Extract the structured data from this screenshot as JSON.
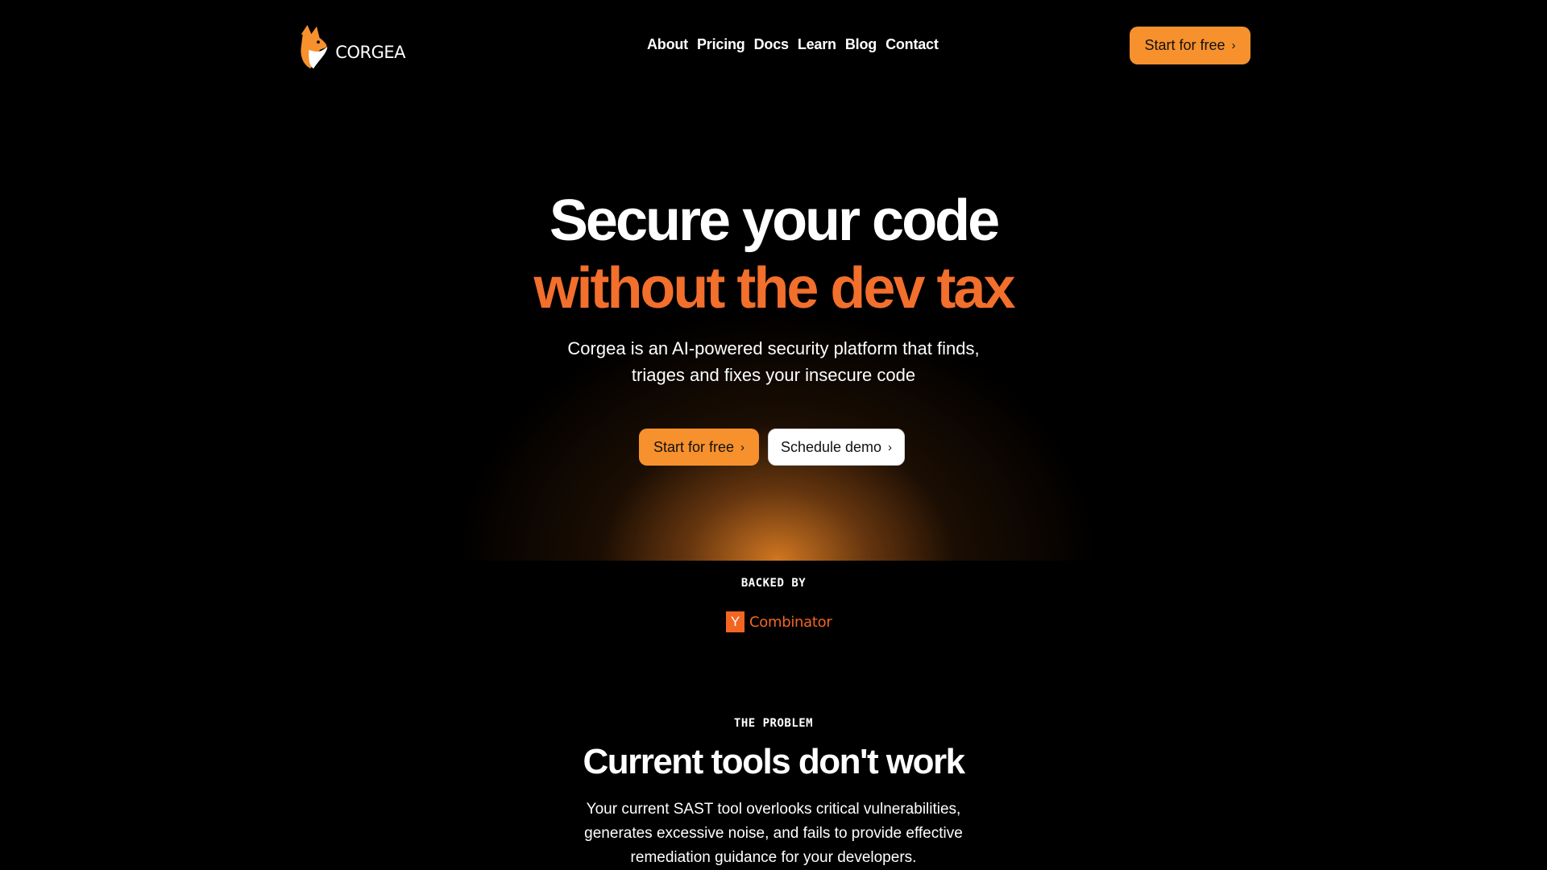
{
  "brand": {
    "logo_text": "CORGEA",
    "accent_color": "#f7912d",
    "headline_accent_color": "#f26f2c",
    "logo_icon": "corgi-icon"
  },
  "nav": {
    "items": [
      {
        "label": "About"
      },
      {
        "label": "Pricing"
      },
      {
        "label": "Docs"
      },
      {
        "label": "Learn"
      },
      {
        "label": "Blog"
      },
      {
        "label": "Contact"
      }
    ],
    "cta_label": "Start for free",
    "cta_icon": "chevron-right-icon"
  },
  "hero": {
    "title_line1": "Secure your code",
    "title_line2": "without the dev tax",
    "subtitle_line1": "Corgea is an AI-powered security platform that finds,",
    "subtitle_line2": "triages and fixes your insecure code",
    "primary_cta": "Start for free",
    "secondary_cta": "Schedule demo"
  },
  "backed_by": {
    "label": "BACKED BY",
    "logo_letter": "Y",
    "logo_name": "Combinator",
    "logo_color": "#f26522"
  },
  "problem": {
    "eyebrow": "THE PROBLEM",
    "title": "Current tools don't work",
    "body_line1": "Your current SAST tool overlooks critical vulnerabilities,",
    "body_line2": "generates excessive noise, and fails to provide effective",
    "body_line3": "remediation guidance for your developers."
  },
  "chevron": "›"
}
